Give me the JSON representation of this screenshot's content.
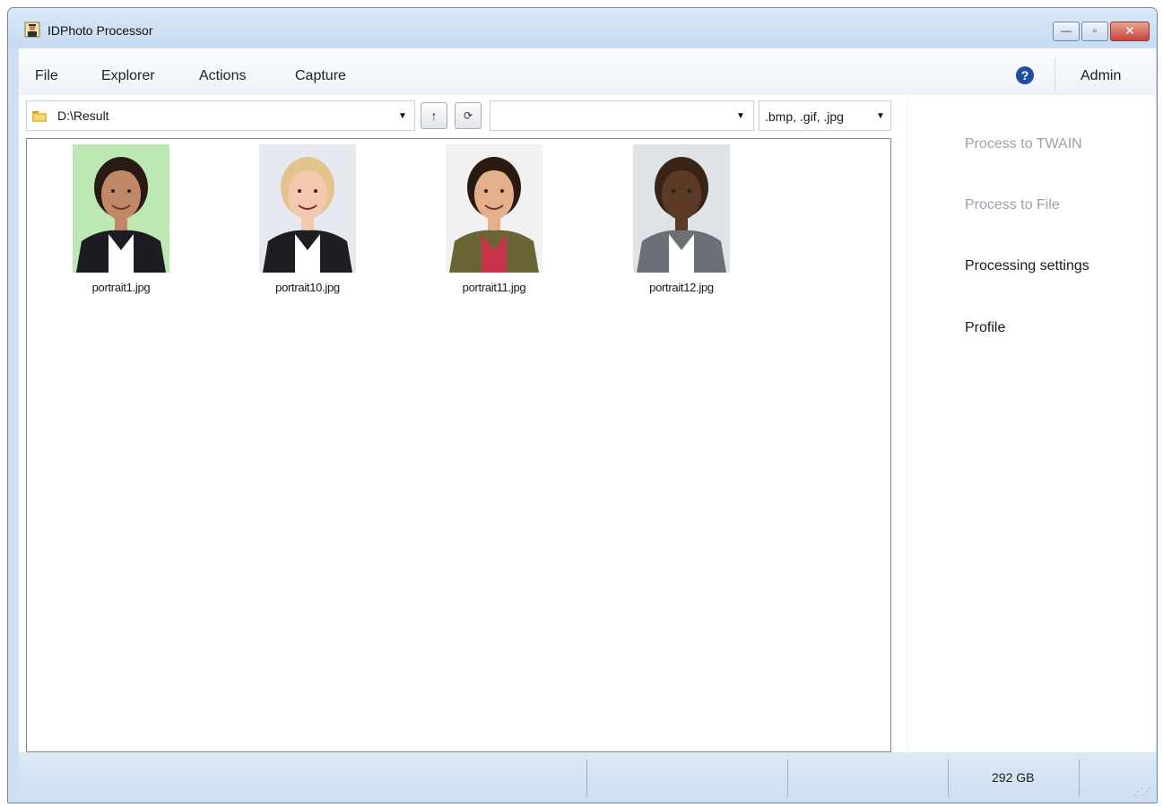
{
  "window": {
    "title": "IDPhoto Processor",
    "controls": {
      "minimize": "—",
      "maximize": "▫",
      "close": "✕"
    }
  },
  "menu": {
    "items": [
      "File",
      "Explorer",
      "Actions",
      "Capture"
    ],
    "help_icon": "?",
    "admin_label": "Admin"
  },
  "toolbar": {
    "path": "D:\\Result",
    "up_icon": "↑",
    "refresh_icon": "⟳",
    "search_value": "",
    "filter": ".bmp, .gif, .jpg",
    "dropdown_arrow": "▼"
  },
  "files": [
    {
      "name": "portrait1.jpg",
      "bg": "#bde8b4",
      "skin": "#c08866",
      "hair": "#2a1a14",
      "shirt": "#ffffff",
      "jacket": "#1c1c22"
    },
    {
      "name": "portrait10.jpg",
      "bg": "#e6eaf0",
      "skin": "#f2c9ae",
      "hair": "#e2c48c",
      "shirt": "#ffffff",
      "jacket": "#1e1e22"
    },
    {
      "name": "portrait11.jpg",
      "bg": "#f1f1f1",
      "skin": "#e3b08b",
      "hair": "#2b1a10",
      "shirt": "#c9324a",
      "jacket": "#6b6535"
    },
    {
      "name": "portrait12.jpg",
      "bg": "#dfe3e8",
      "skin": "#5b3a28",
      "hair": "#3a2418",
      "shirt": "#ffffff",
      "jacket": "#6c7076"
    }
  ],
  "side_panel": {
    "items": [
      {
        "label": "Process to TWAIN",
        "enabled": false
      },
      {
        "label": "Process to File",
        "enabled": false
      },
      {
        "label": "Processing settings",
        "enabled": true
      },
      {
        "label": "Profile",
        "enabled": true
      }
    ]
  },
  "status": {
    "disk_free": "292 GB"
  },
  "icons": {
    "app": "passport-photo-icon",
    "folder": "folder-icon",
    "help": "help-icon"
  }
}
